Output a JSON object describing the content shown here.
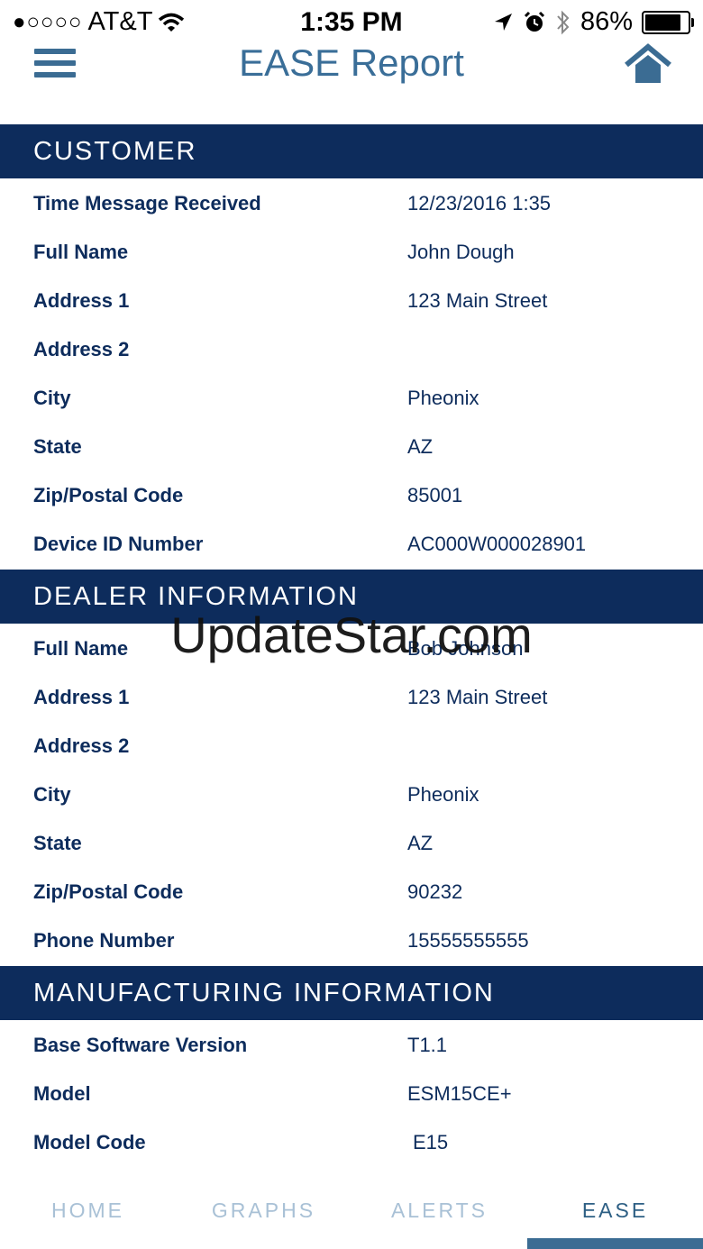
{
  "status_bar": {
    "signal_dots": "●○○○○",
    "carrier": "AT&T",
    "time": "1:35 PM",
    "battery": "86%",
    "battery_level": 0.86
  },
  "header": {
    "title": "EASE Report"
  },
  "sections": {
    "customer": {
      "title": "CUSTOMER",
      "rows": [
        {
          "label": "Time Message Received",
          "value": "12/23/2016 1:35"
        },
        {
          "label": "Full Name",
          "value": "John Dough"
        },
        {
          "label": "Address 1",
          "value": "123 Main Street"
        },
        {
          "label": "Address 2",
          "value": ""
        },
        {
          "label": "City",
          "value": "Pheonix"
        },
        {
          "label": "State",
          "value": "AZ"
        },
        {
          "label": "Zip/Postal Code",
          "value": "85001"
        },
        {
          "label": "Device ID Number",
          "value": "AC000W000028901"
        }
      ]
    },
    "dealer": {
      "title": "DEALER INFORMATION",
      "rows": [
        {
          "label": "Full Name",
          "value": "Bob Johnson"
        },
        {
          "label": "Address 1",
          "value": "123 Main Street"
        },
        {
          "label": "Address 2",
          "value": ""
        },
        {
          "label": "City",
          "value": "Pheonix"
        },
        {
          "label": "State",
          "value": "AZ"
        },
        {
          "label": "Zip/Postal Code",
          "value": "90232"
        },
        {
          "label": "Phone Number",
          "value": "15555555555"
        }
      ]
    },
    "manufacturing": {
      "title": "MANUFACTURING INFORMATION",
      "rows": [
        {
          "label": "Base Software Version",
          "value": "T1.1"
        },
        {
          "label": "Model",
          "value": "ESM15CE+"
        },
        {
          "label": "Model Code",
          "value": "E15"
        }
      ]
    }
  },
  "tabs": [
    {
      "label": "HOME"
    },
    {
      "label": "GRAPHS"
    },
    {
      "label": "ALERTS"
    },
    {
      "label": "EASE"
    }
  ],
  "watermark": "UpdateStar.com",
  "icons": {
    "menu": "hamburger-icon",
    "home": "home-icon",
    "wifi": "wifi-icon",
    "location": "location-arrow-icon",
    "alarm": "alarm-icon",
    "bluetooth": "bluetooth-icon",
    "battery": "battery-icon"
  },
  "colors": {
    "section_bg": "#0d2c5c",
    "accent": "#3b6c93",
    "tab_inactive": "#a9c1d6"
  }
}
